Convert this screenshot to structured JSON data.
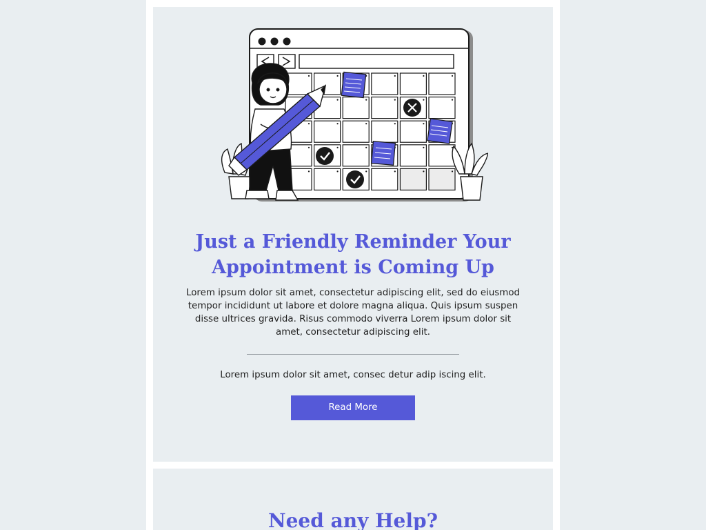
{
  "reminder": {
    "headline": "Just a Friendly Reminder Your Appointment is Coming Up",
    "body": "Lorem ipsum dolor sit amet, consectetur adipiscing elit, sed do eiusmod tempor incididunt ut labore et dolore magna aliqua. Quis ipsum suspen disse ultrices gravida. Risus commodo viverra Lorem ipsum dolor sit amet, consectetur adipiscing elit.",
    "note": "Lorem ipsum dolor sit amet, consec detur adip iscing elit.",
    "cta_label": "Read More",
    "illustration_icon": "calendar-with-person-and-pencil-illustration"
  },
  "help": {
    "title": "Need any Help?"
  },
  "colors": {
    "page_background": "#e9eef1",
    "column_background": "#ffffff",
    "accent": "#5559d8",
    "text": "#222222"
  }
}
